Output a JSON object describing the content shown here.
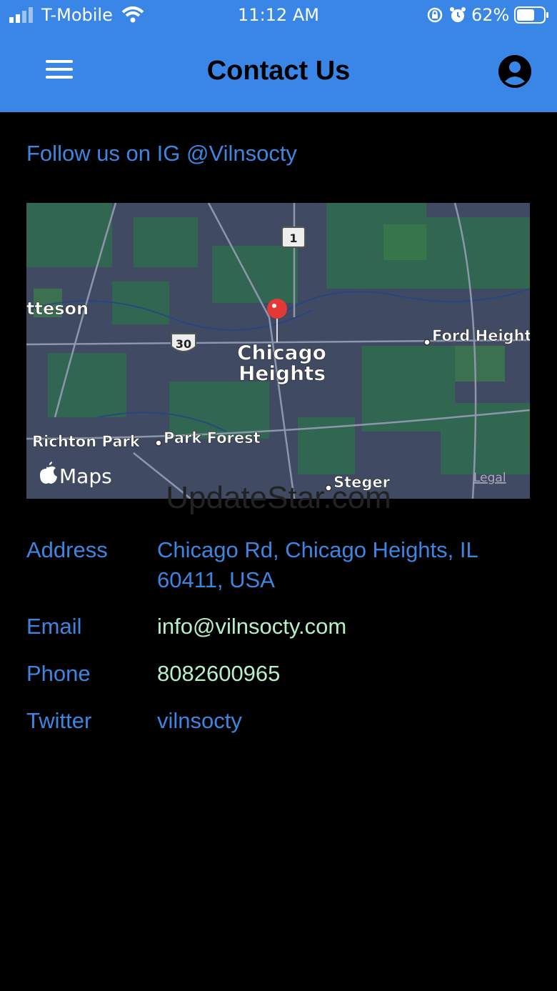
{
  "status_bar": {
    "carrier": "T-Mobile",
    "time": "11:12 AM",
    "battery": "62%"
  },
  "header": {
    "title": "Contact Us",
    "menu_icon": "hamburger-icon",
    "profile_icon": "account-circle-icon",
    "bg_color": "#3a86e6"
  },
  "follow": {
    "text": "Follow us on IG @Vilnsocty"
  },
  "map": {
    "labels": {
      "city": "Chicago",
      "city2": "Heights",
      "west": "tteson",
      "ford": "Ford Heights",
      "richton": "Richton Park",
      "park_forest": "Park Forest",
      "steger": "Steger",
      "route1": "1",
      "route30": "30",
      "maps_brand": "Maps",
      "legal": "Legal"
    }
  },
  "watermark": "UpdateStar.com",
  "contact": {
    "address_label": "Address",
    "address_line1": "Chicago Rd, Chicago Heights, IL",
    "address_line2": "60411, USA",
    "email_label": "Email",
    "email_value": "info@vilnsocty.com",
    "phone_label": "Phone",
    "phone_value": "8082600965",
    "twitter_label": "Twitter",
    "twitter_value": "vilnsocty"
  },
  "colors": {
    "accent": "#3c86e2",
    "value_green": "#b5f0c8"
  }
}
